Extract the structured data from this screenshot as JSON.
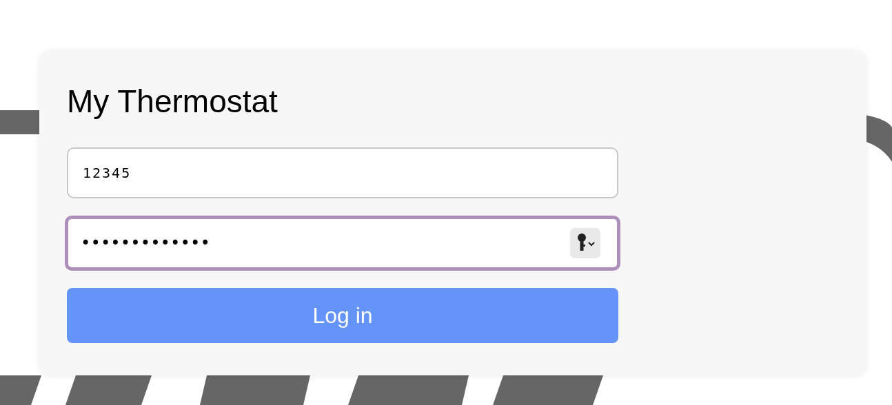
{
  "card": {
    "title": "My Thermostat"
  },
  "username": {
    "value": "12345",
    "focused": false
  },
  "password": {
    "value": "•••••••••••••",
    "focused": true
  },
  "login_button": {
    "label": "Log in"
  }
}
